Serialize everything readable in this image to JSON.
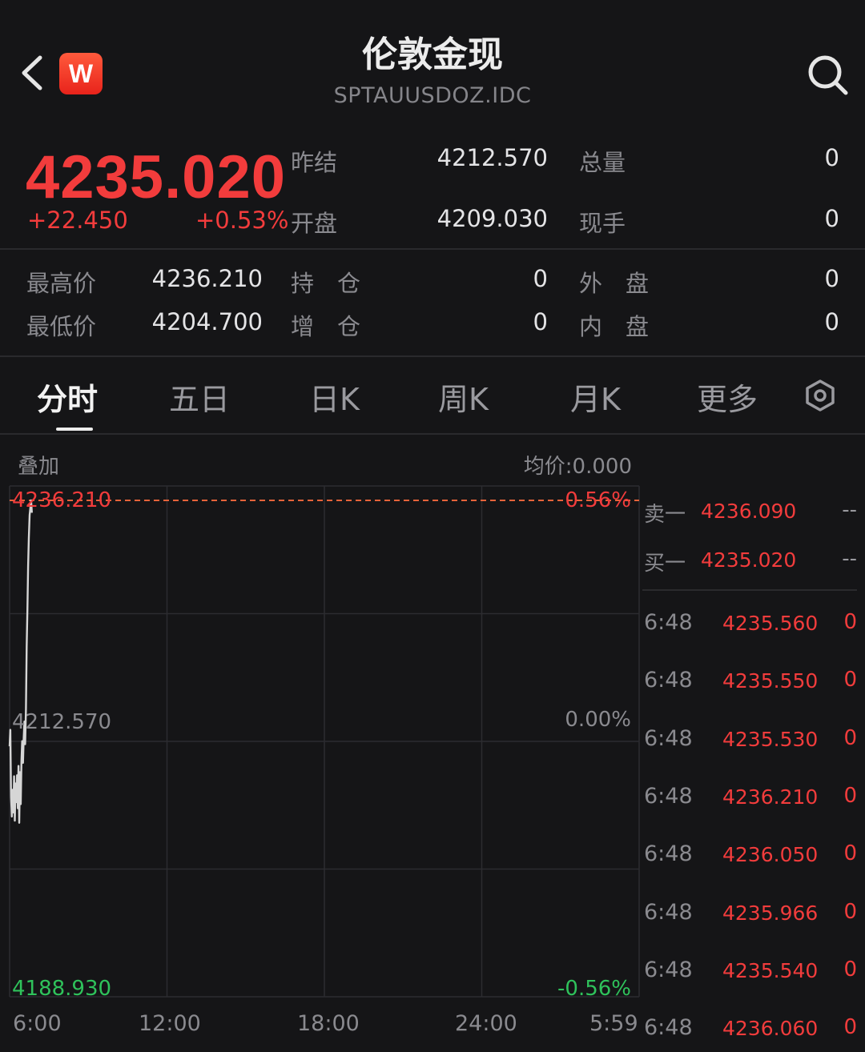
{
  "header": {
    "title": "伦敦金现",
    "subtitle": "SPTAUUSDOZ.IDC",
    "logo_text": "W"
  },
  "quote": {
    "price": "4235.020",
    "change": "+22.450",
    "change_pct": "+0.53%",
    "stats": [
      {
        "label": "昨结",
        "value": "4212.570"
      },
      {
        "label": "总量",
        "value": "0"
      },
      {
        "label": "开盘",
        "value": "4209.030"
      },
      {
        "label": "现手",
        "value": "0"
      },
      {
        "label": "最高价",
        "value": "4236.210"
      },
      {
        "label": "持　仓",
        "value": "0"
      },
      {
        "label": "外　盘",
        "value": "0"
      },
      {
        "label": "最低价",
        "value": "4204.700"
      },
      {
        "label": "增　仓",
        "value": "0"
      },
      {
        "label": "内　盘",
        "value": "0"
      }
    ]
  },
  "tabs": [
    "分时",
    "五日",
    "日K",
    "周K",
    "月K",
    "更多"
  ],
  "chart": {
    "overlay_label": "叠加",
    "avg_label": "均价:0.000",
    "y_top": "4236.210",
    "y_mid": "4212.570",
    "y_bottom": "4188.930",
    "pct_top": "0.56%",
    "pct_mid": "0.00%",
    "pct_bottom": "-0.56%",
    "x_ticks": [
      "6:00",
      "12:00",
      "18:00",
      "24:00",
      "5:59"
    ]
  },
  "chart_data": {
    "type": "line",
    "ylim": [
      4188.93,
      4236.21
    ],
    "x": [
      0,
      0.5,
      1,
      1.5,
      2,
      2.5,
      3,
      3.5,
      4,
      4.5,
      5,
      5.5,
      6,
      6.5,
      7,
      7.5,
      8,
      8.5,
      9,
      9.5,
      10,
      10.5,
      11,
      11.5,
      12,
      12.5,
      13,
      13.5,
      14,
      14.5,
      15
    ],
    "series": [
      {
        "values": [
          4212.4,
          4214.0,
          4207.5,
          4205.6,
          4208.2,
          4206.0,
          4209.5,
          4205.2,
          4208.8,
          4207.0,
          4209.6,
          4206.4,
          4210.5,
          4205.0,
          4209.9,
          4206.8,
          4211.0,
          4212.9,
          4210.8,
          4213.2,
          4214.8,
          4212.6,
          4216.0,
          4222.0,
          4225.5,
          4229.8,
          4232.6,
          4234.8,
          4235.5,
          4236.21,
          4235.02
        ]
      }
    ]
  },
  "orderbook": {
    "sell": {
      "label": "卖一",
      "price": "4236.090",
      "vol": "--"
    },
    "buy": {
      "label": "买一",
      "price": "4235.020",
      "vol": "--"
    }
  },
  "ticks": [
    {
      "time": "6:48",
      "price": "4235.560",
      "vol": "0"
    },
    {
      "time": "6:48",
      "price": "4235.550",
      "vol": "0"
    },
    {
      "time": "6:48",
      "price": "4235.530",
      "vol": "0"
    },
    {
      "time": "6:48",
      "price": "4236.210",
      "vol": "0"
    },
    {
      "time": "6:48",
      "price": "4236.050",
      "vol": "0"
    },
    {
      "time": "6:48",
      "price": "4235.966",
      "vol": "0"
    },
    {
      "time": "6:48",
      "price": "4235.540",
      "vol": "0"
    },
    {
      "time": "6:48",
      "price": "4236.060",
      "vol": "0"
    }
  ],
  "colors": {
    "up": "#f23c3c",
    "down": "#2fc25b",
    "background": "#151517",
    "grid": "#2c2c30",
    "line": "#d6d6d6"
  }
}
